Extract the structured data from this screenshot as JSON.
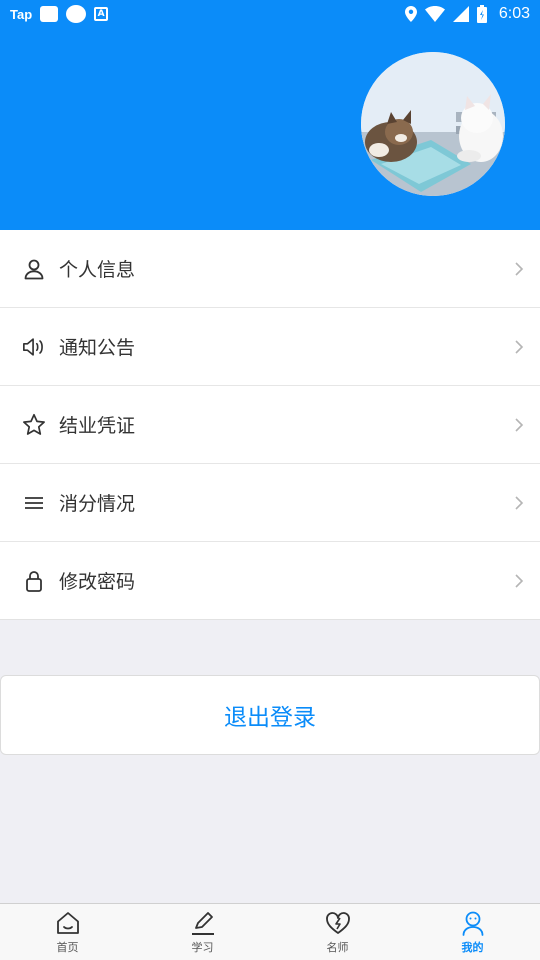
{
  "status_bar": {
    "app_label": "Tap",
    "time": "6:03",
    "icons": [
      "app-square-icon",
      "infinity-app-icon",
      "a-app-icon",
      "location-icon",
      "wifi-icon",
      "cell-signal-icon",
      "battery-icon"
    ]
  },
  "colors": {
    "accent": "#0b8cf9",
    "background": "#efeff4"
  },
  "profile": {
    "avatar_icon": "cats-avatar-image"
  },
  "menu": {
    "items": [
      {
        "label": "个人信息",
        "icon": "person-icon"
      },
      {
        "label": "通知公告",
        "icon": "speaker-icon"
      },
      {
        "label": "结业凭证",
        "icon": "star-icon"
      },
      {
        "label": "消分情况",
        "icon": "list-icon"
      },
      {
        "label": "修改密码",
        "icon": "lock-icon"
      }
    ]
  },
  "logout": {
    "label": "退出登录"
  },
  "tabbar": {
    "tabs": [
      {
        "label": "首页",
        "icon": "home-icon",
        "active": false
      },
      {
        "label": "学习",
        "icon": "pencil-icon",
        "active": false
      },
      {
        "label": "名师",
        "icon": "heart-icon",
        "active": false
      },
      {
        "label": "我的",
        "icon": "user-icon",
        "active": true
      }
    ]
  }
}
